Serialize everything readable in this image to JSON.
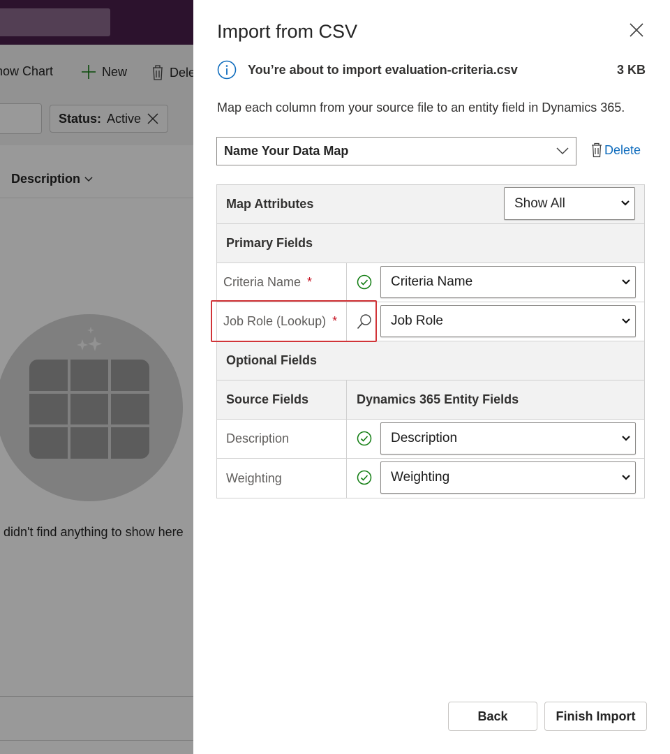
{
  "background": {
    "command_bar": {
      "show_chart_label": "how Chart",
      "new_label": "New",
      "delete_label": "Dele"
    },
    "filter": {
      "status_key": "Status:",
      "status_value": "Active"
    },
    "grid": {
      "column_header": "Description"
    },
    "empty_state_text": "e didn't find anything to show here"
  },
  "dialog": {
    "title": "Import from CSV",
    "info_text": "You’re about to import evaluation-criteria.csv",
    "file_size": "3 KB",
    "description": "Map each column from your source file to an entity field in Dynamics 365.",
    "data_map_placeholder": "Name Your Data Map",
    "delete_label": "Delete",
    "map_attributes_label": "Map Attributes",
    "show_filter": "Show All",
    "primary_fields_header": "Primary Fields",
    "primary_fields": [
      {
        "source": "Criteria Name",
        "required": "*",
        "status_icon": "check-circle-icon",
        "target": "Criteria Name"
      },
      {
        "source": "Job Role (Lookup)",
        "required": "*",
        "status_icon": "search-icon",
        "target": "Job Role"
      }
    ],
    "optional_fields_header": "Optional Fields",
    "columns": {
      "source": "Source Fields",
      "target": "Dynamics 365 Entity Fields"
    },
    "optional_fields": [
      {
        "source": "Description",
        "status_icon": "check-circle-icon",
        "target": "Description"
      },
      {
        "source": "Weighting",
        "status_icon": "check-circle-icon",
        "target": "Weighting"
      }
    ],
    "back_label": "Back",
    "finish_label": "Finish Import"
  },
  "colors": {
    "brand_topbar": "#4a1e4b",
    "accent_link": "#0f6cbd",
    "success_check": "#107c10",
    "required": "#c50f1f",
    "highlight_border": "#d13438"
  }
}
